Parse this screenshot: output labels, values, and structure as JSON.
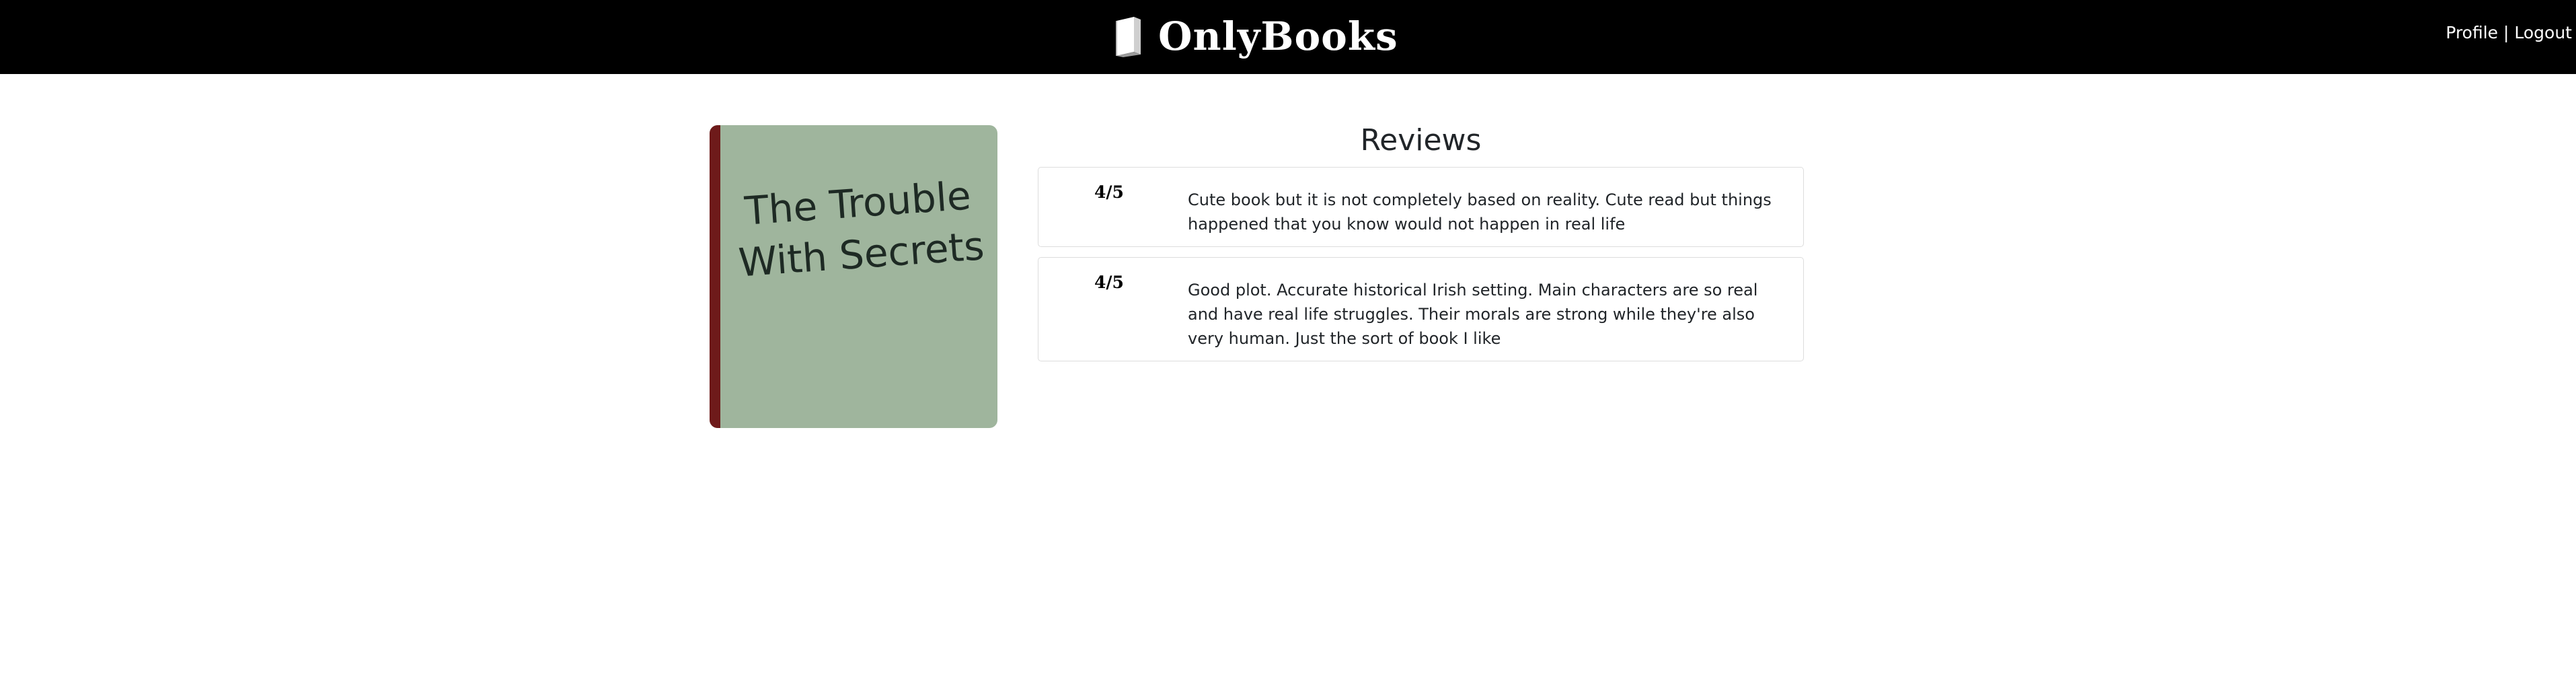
{
  "navbar": {
    "brand": "OnlyBooks",
    "brand_icon": "book-icon",
    "profile_label": "Profile",
    "separator": "|",
    "logout_label": "Logout",
    "background": "#000000"
  },
  "book": {
    "title": "The Trouble With Secrets",
    "cover_color": "#9fb59d",
    "spine_color": "#6e1a1a"
  },
  "reviews": {
    "heading": "Reviews",
    "items": [
      {
        "rating": "4/5",
        "text": "Cute book but it is not completely based on reality. Cute read but things happened that you know would not happen in real life"
      },
      {
        "rating": "4/5",
        "text": "Good plot. Accurate historical Irish setting. Main characters are so real and have real life struggles. Their morals are strong while they're also very human. Just the sort of book I like"
      }
    ]
  }
}
